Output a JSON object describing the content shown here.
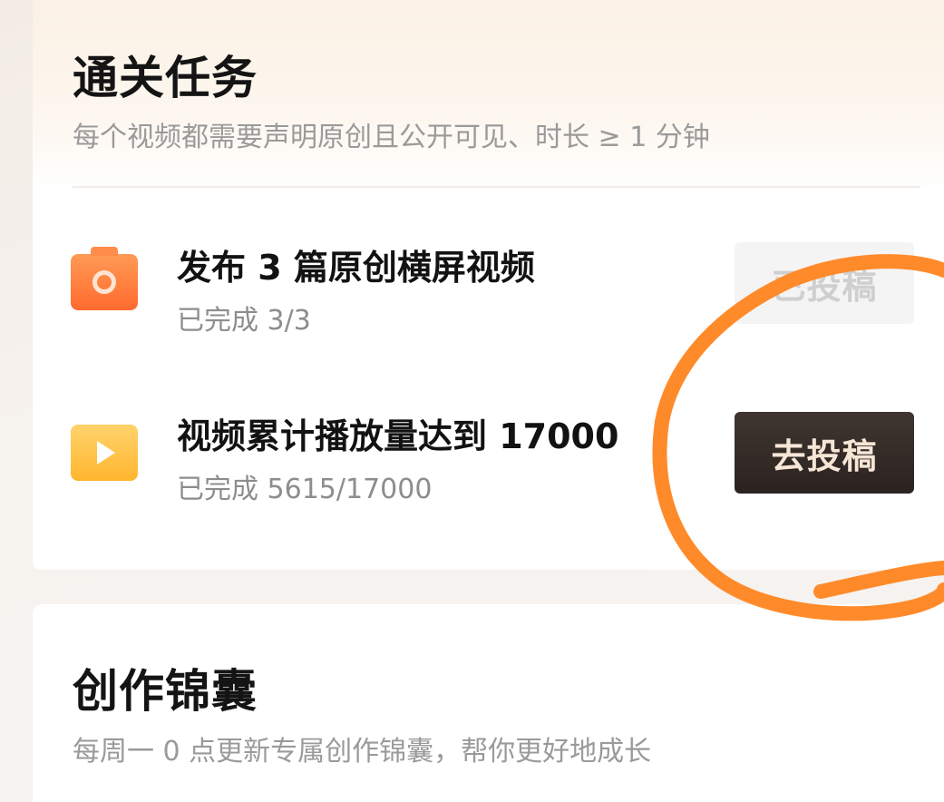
{
  "clearance_tasks": {
    "title": "通关任务",
    "subtitle": "每个视频都需要声明原创且公开可见、时长 ≥ 1 分钟",
    "tasks": [
      {
        "icon": "camera-icon",
        "title": "发布 3 篇原创横屏视频",
        "progress": "已完成 3/3",
        "button_label": "已投稿",
        "button_state": "disabled"
      },
      {
        "icon": "play-icon",
        "title": "视频累计播放量达到 17000",
        "progress": "已完成 5615/17000",
        "button_label": "去投稿",
        "button_state": "active"
      }
    ]
  },
  "creation_kit": {
    "title": "创作锦囊",
    "subtitle": "每周一 0 点更新专属创作锦囊，帮你更好地成长"
  },
  "colors": {
    "camera_icon": "#ff7a38",
    "play_icon": "#ffc043",
    "go_button": "#342b27",
    "annotation_stroke": "#ff8a2a"
  }
}
